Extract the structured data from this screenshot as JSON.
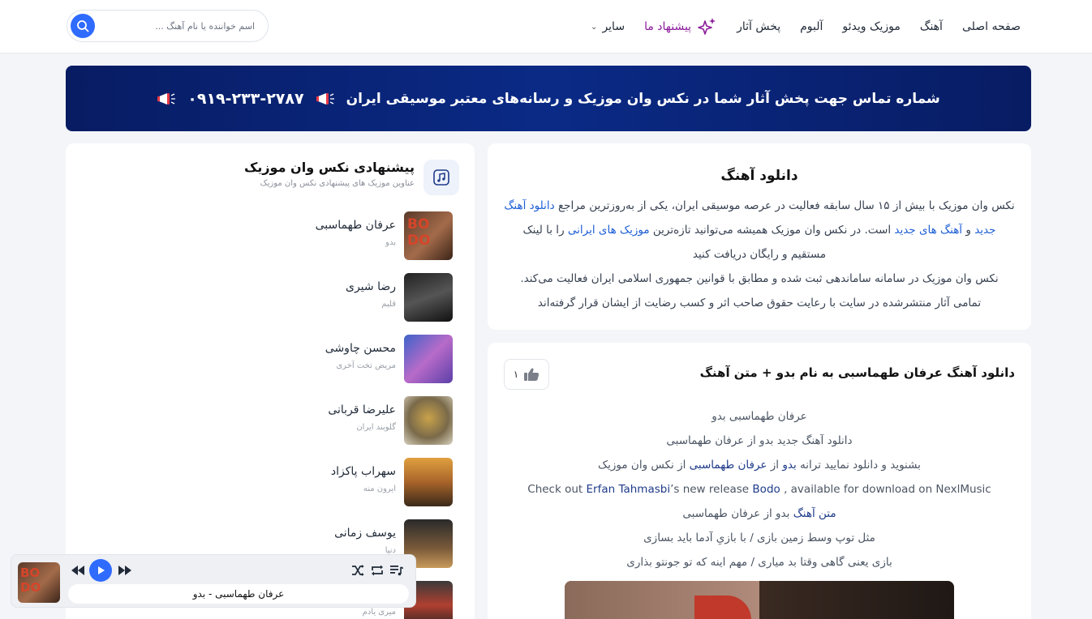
{
  "header": {
    "nav": [
      {
        "label": "صفحه اصلی"
      },
      {
        "label": "آهنگ"
      },
      {
        "label": "موزیک ویدئو"
      },
      {
        "label": "آلبوم"
      },
      {
        "label": "پخش آثار"
      },
      {
        "label": "پیشنهاد ما"
      },
      {
        "label": "سایر"
      }
    ],
    "search_placeholder": "اسم خواننده یا نام آهنگ ...",
    "search_icon": "search-icon"
  },
  "banner": {
    "text": "شماره تماس جهت پخش آثار شما در نکس وان موزیک و رسانه‌های معتبر موسیقی ایران",
    "phone": "۰۹۱۹-۲۳۳-۲۷۸۷",
    "icon": "megaphone-icon"
  },
  "sidebar": {
    "title": "پیشنهادی نکس وان موزیک",
    "subtitle": "عناوین موزیک های پیشنهادی نکس وان موزیک",
    "songs": [
      {
        "artist": "عرفان طهماسبی",
        "title": "بدو"
      },
      {
        "artist": "رضا شیری",
        "title": "قلبم"
      },
      {
        "artist": "محسن چاوشی",
        "title": "مریض تخت آخری"
      },
      {
        "artist": "علیرضا قربانی",
        "title": "گلوبند ایران"
      },
      {
        "artist": "سهراب پاکزاد",
        "title": "ایرون منه"
      },
      {
        "artist": "یوسف زمانی",
        "title": "دنیا"
      },
      {
        "artist": "",
        "title": "میری یادم"
      }
    ]
  },
  "intro": {
    "title": "دانلود آهنگ",
    "p1_a": "نکس وان موزیک با بیش از ۱۵ سال سابقه فعالیت در عرصه موسیقی ایران، یکی از به‌روزترین مراجع",
    "link1": "دانلود آهنگ جدید",
    "and": "و",
    "link2": "آهنگ های جدید",
    "p1_b": "است. در نکس وان موزیک همیشه می‌توانید تازه‌ترین",
    "link3": "موزیک های ایرانی",
    "p1_c": "را با لینک مستقیم و رایگان دریافت کنید",
    "p2": "نکس وان موزیک در سامانه ساماندهی ثبت شده و مطابق با قوانین جمهوری اسلامی ایران فعالیت می‌کند.",
    "p3": "تمامی آثار منتشرشده در سایت با رعایت حقوق صاحب اثر و کسب رضایت از ایشان قرار گرفته‌اند"
  },
  "post": {
    "title": "دانلود آهنگ عرفان طهماسبی به نام بدو + متن آهنگ",
    "likes": "۱",
    "line1": "عرفان طهماسبی بدو",
    "line2": "دانلود آهنگ جدید بدو از عرفان طهماسبی",
    "line3_a": "بشنوید و دانلود نمایید ترانه",
    "line3_song": "بدو",
    "line3_b": "از",
    "line3_artist": "عرفان طهماسبی",
    "line3_c": "از نکس وان موزیک",
    "line4_a": "Check out",
    "line4_artist": "Erfan Tahmasbi",
    "line4_b": "’s new release",
    "line4_song": "Bodo",
    "line4_c": ", available for download on NexlMusic",
    "line5_a": "متن آهنگ",
    "line5_b": "بدو از عرفان طهماسبی",
    "line6": "مثل توپ وسط زمین بازی / با بازیِ آدما باید بسازی",
    "line7": "بازی یعنی گاهی وقتا بد میاری / مهم اینه که تو جونتو بذاری"
  },
  "player": {
    "now_playing": "عرفان طهماسبی - بدو"
  },
  "colors": {
    "accent": "#2f6bff",
    "banner": "#0a2a86",
    "link": "#1d5fd6",
    "suggest": "#8b1a9b"
  }
}
